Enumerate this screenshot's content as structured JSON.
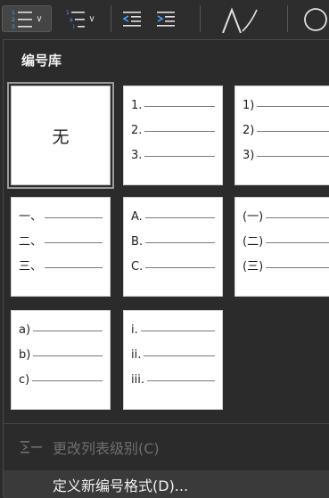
{
  "ribbon": {
    "bullets_icon": "bulleted-list-icon",
    "multilevel_icon": "multilevel-list-icon",
    "decrease_indent_icon": "decrease-indent-icon",
    "increase_indent_icon": "increase-indent-icon"
  },
  "panel": {
    "title": "编号库",
    "tiles": [
      {
        "type": "none",
        "label": "无"
      },
      {
        "markers": [
          "1.",
          "2.",
          "3."
        ]
      },
      {
        "markers": [
          "1)",
          "2)",
          "3)"
        ]
      },
      {
        "markers": [
          "一、",
          "二、",
          "三、"
        ]
      },
      {
        "markers": [
          "A.",
          "B.",
          "C."
        ]
      },
      {
        "markers": [
          "(一)",
          "(二)",
          "(三)"
        ]
      },
      {
        "markers": [
          "a)",
          "b)",
          "c)"
        ]
      },
      {
        "markers": [
          "i.",
          "ii.",
          "iii."
        ]
      }
    ],
    "change_level": "更改列表级别(C)",
    "define_format": "定义新编号格式(D)..."
  }
}
